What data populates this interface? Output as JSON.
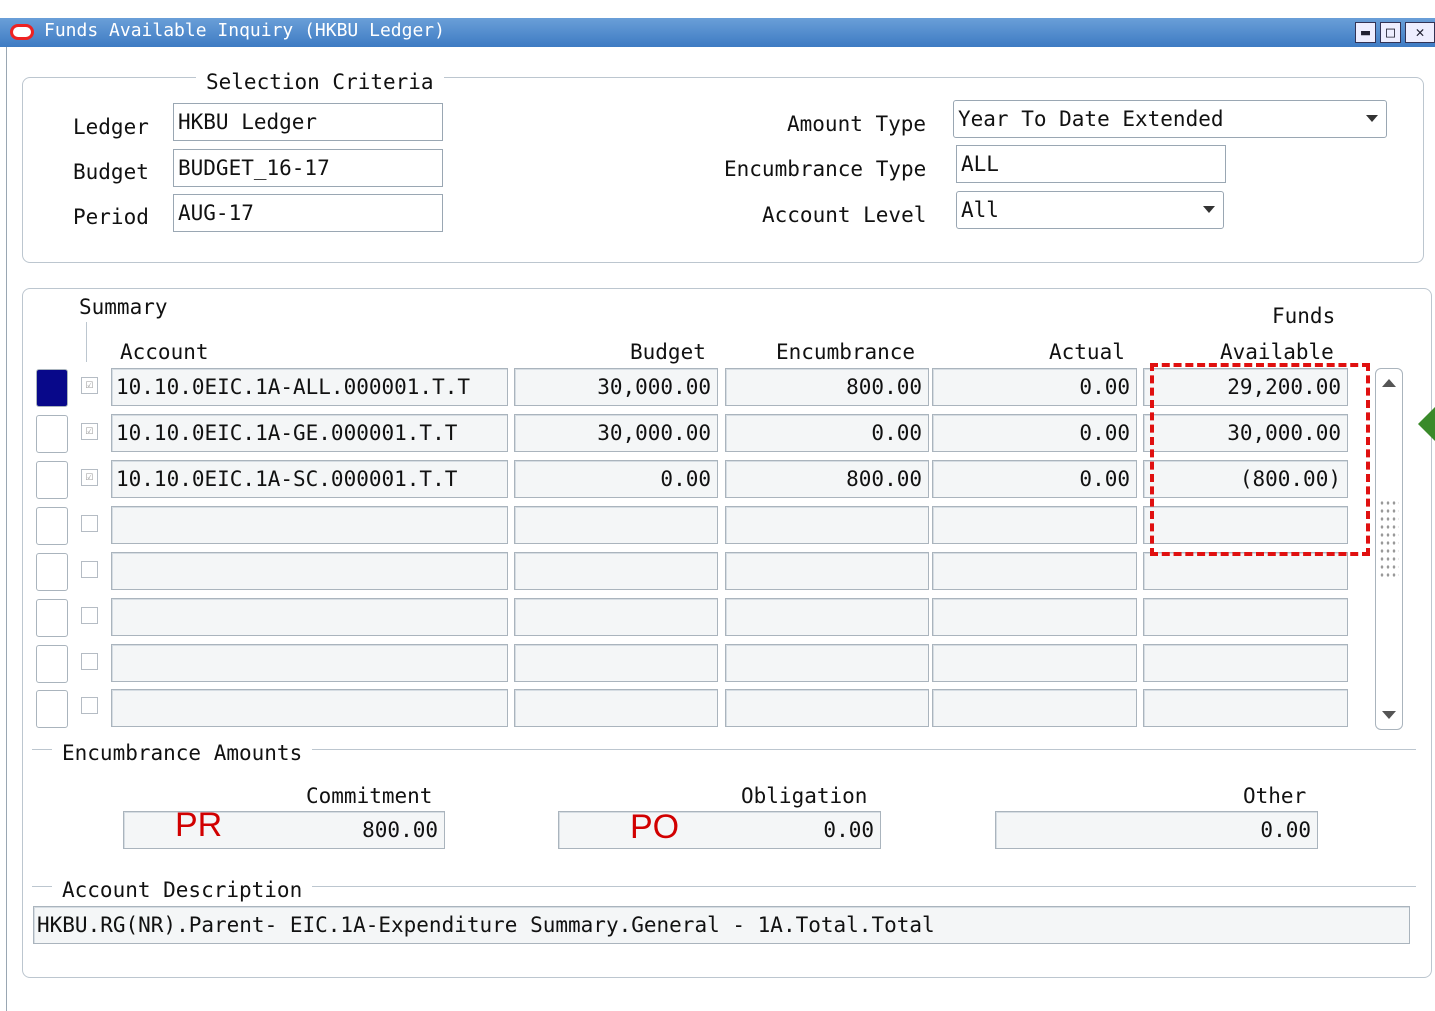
{
  "window": {
    "title": "Funds Available Inquiry (HKBU Ledger)",
    "buttons": [
      "minimize",
      "maximize",
      "close"
    ]
  },
  "selection_criteria": {
    "legend": "Selection Criteria",
    "ledger_label": "Ledger",
    "ledger_value": "HKBU Ledger",
    "budget_label": "Budget",
    "budget_value": "BUDGET_16-17",
    "period_label": "Period",
    "period_value": "AUG-17",
    "amount_type_label": "Amount Type",
    "amount_type_value": "Year To Date Extended",
    "encumbrance_type_label": "Encumbrance Type",
    "encumbrance_type_value": "ALL",
    "account_level_label": "Account Level",
    "account_level_value": "All"
  },
  "summary": {
    "legend": "Summary",
    "columns": {
      "account": "Account",
      "budget": "Budget",
      "encumbrance": "Encumbrance",
      "actual": "Actual",
      "funds_available_line1": "Funds",
      "funds_available_line2": "Available"
    },
    "rows": [
      {
        "account": "10.10.0EIC.1A-ALL.000001.T.T",
        "budget": "30,000.00",
        "encumbrance": "800.00",
        "actual": "0.00",
        "funds_available": "29,200.00"
      },
      {
        "account": "10.10.0EIC.1A-GE.000001.T.T",
        "budget": "30,000.00",
        "encumbrance": "0.00",
        "actual": "0.00",
        "funds_available": "30,000.00"
      },
      {
        "account": "10.10.0EIC.1A-SC.000001.T.T",
        "budget": "0.00",
        "encumbrance": "800.00",
        "actual": "0.00",
        "funds_available": "(800.00)"
      },
      {
        "account": "",
        "budget": "",
        "encumbrance": "",
        "actual": "",
        "funds_available": ""
      },
      {
        "account": "",
        "budget": "",
        "encumbrance": "",
        "actual": "",
        "funds_available": ""
      },
      {
        "account": "",
        "budget": "",
        "encumbrance": "",
        "actual": "",
        "funds_available": ""
      },
      {
        "account": "",
        "budget": "",
        "encumbrance": "",
        "actual": "",
        "funds_available": ""
      },
      {
        "account": "",
        "budget": "",
        "encumbrance": "",
        "actual": "",
        "funds_available": ""
      }
    ]
  },
  "encumbrance_amounts": {
    "legend": "Encumbrance Amounts",
    "commitment_label": "Commitment",
    "commitment_value": "800.00",
    "obligation_label": "Obligation",
    "obligation_value": "0.00",
    "other_label": "Other",
    "other_value": "0.00"
  },
  "account_description": {
    "legend": "Account Description",
    "value": "HKBU.RG(NR).Parent- EIC.1A-Expenditure Summary.General - 1A.Total.Total"
  },
  "annotations": {
    "pr": "PR",
    "po": "PO",
    "highlight_color": "#e01010",
    "arrow_color": "#3a8a2a"
  }
}
